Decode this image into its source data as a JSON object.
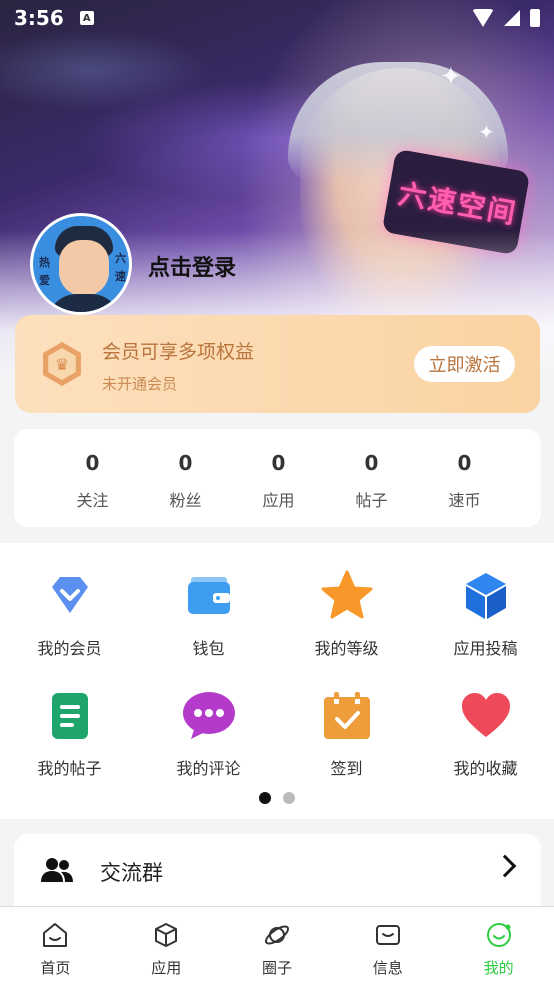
{
  "status_bar": {
    "time": "3:56",
    "a_label": "A"
  },
  "hero": {
    "sign_text": "六速空间"
  },
  "profile": {
    "login_text": "点击登录",
    "avatar_tags": [
      "热",
      "爱",
      "六",
      "速"
    ]
  },
  "membership": {
    "title": "会员可享多项权益",
    "subtitle": "未开通会员",
    "button": "立即激活"
  },
  "stats": [
    {
      "value": "0",
      "label": "关注"
    },
    {
      "value": "0",
      "label": "粉丝"
    },
    {
      "value": "0",
      "label": "应用"
    },
    {
      "value": "0",
      "label": "帖子"
    },
    {
      "value": "0",
      "label": "速币"
    }
  ],
  "grid": {
    "items": [
      {
        "label": "我的会员",
        "icon": "diamond-icon"
      },
      {
        "label": "钱包",
        "icon": "wallet-icon"
      },
      {
        "label": "我的等级",
        "icon": "star-icon"
      },
      {
        "label": "应用投稿",
        "icon": "cube-icon"
      },
      {
        "label": "我的帖子",
        "icon": "document-icon"
      },
      {
        "label": "我的评论",
        "icon": "comment-icon"
      },
      {
        "label": "签到",
        "icon": "calendar-check-icon"
      },
      {
        "label": "我的收藏",
        "icon": "heart-icon"
      }
    ],
    "page_index": 1,
    "page_count": 2
  },
  "group": {
    "label": "交流群"
  },
  "tabbar": {
    "tabs": [
      {
        "label": "首页",
        "icon": "home-icon"
      },
      {
        "label": "应用",
        "icon": "box-icon"
      },
      {
        "label": "圈子",
        "icon": "planet-icon"
      },
      {
        "label": "信息",
        "icon": "message-icon"
      },
      {
        "label": "我的",
        "icon": "smile-icon"
      }
    ],
    "active": "我的",
    "active_color": "#2ecc40"
  }
}
